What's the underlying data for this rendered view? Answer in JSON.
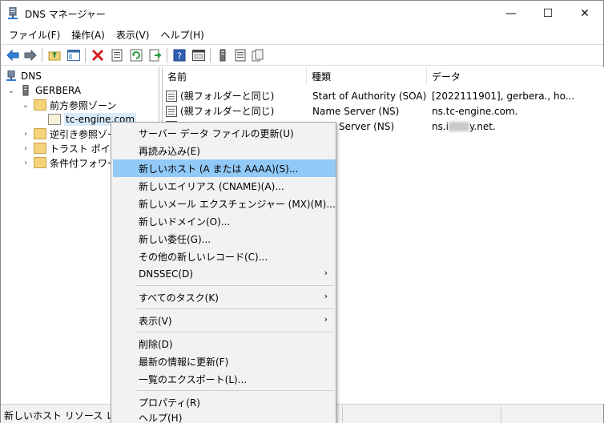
{
  "window": {
    "title": "DNS マネージャー"
  },
  "controls": {
    "minimize": "—",
    "maximize": "☐",
    "close": "✕"
  },
  "menubar": [
    "ファイル(F)",
    "操作(A)",
    "表示(V)",
    "ヘルプ(H)"
  ],
  "tree": {
    "root": "DNS",
    "server": "GERBERA",
    "forward_zones": "前方参照ゾーン",
    "zone": "tc-engine.com",
    "reverse_zones": "逆引き参照ゾー",
    "trust_points": "トラスト ポイント",
    "conditional": "条件付フォワー"
  },
  "list": {
    "columns": [
      "名前",
      "種類",
      "データ"
    ],
    "rows": [
      {
        "name": "(親フォルダーと同じ)",
        "type": "Start of Authority (SOA)",
        "data": "[2022111901], gerbera., ho..."
      },
      {
        "name": "(親フォルダーと同じ)",
        "type": "Name Server (NS)",
        "data": "ns.tc-engine.com."
      },
      {
        "name": "",
        "type": "Server (NS)",
        "data_prefix": "ns.i",
        "data_suffix": "y.net."
      }
    ]
  },
  "context_menu": {
    "items": [
      {
        "label": "サーバー データ ファイルの更新(U)"
      },
      {
        "label": "再読み込み(E)"
      },
      {
        "label": "新しいホスト (A または AAAA)(S)..."
      },
      {
        "label": "新しいエイリアス (CNAME)(A)..."
      },
      {
        "label": "新しいメール エクスチェンジャー (MX)(M)..."
      },
      {
        "label": "新しいドメイン(O)..."
      },
      {
        "label": "新しい委任(G)..."
      },
      {
        "label": "その他の新しいレコード(C)..."
      },
      {
        "label": "DNSSEC(D)"
      },
      {
        "label": "すべてのタスク(K)"
      },
      {
        "label": "表示(V)"
      },
      {
        "label": "削除(D)"
      },
      {
        "label": "最新の情報に更新(F)"
      },
      {
        "label": "一覧のエクスポート(L)..."
      },
      {
        "label": "プロパティ(R)"
      },
      {
        "label": "ヘルプ(H)"
      }
    ],
    "submenu_arrow": "›"
  },
  "statusbar": {
    "text": "新しいホスト リソース レコードを"
  },
  "colors": {
    "highlight": "#91c9f7",
    "selection": "#d9ebf9"
  },
  "icons": [
    "back-icon",
    "forward-icon",
    "up-folder-icon",
    "show-tree-icon",
    "delete-icon",
    "properties-icon",
    "refresh-icon",
    "export-icon",
    "help-icon",
    "view-icon",
    "server-icon",
    "list-icon",
    "copy-icon"
  ]
}
